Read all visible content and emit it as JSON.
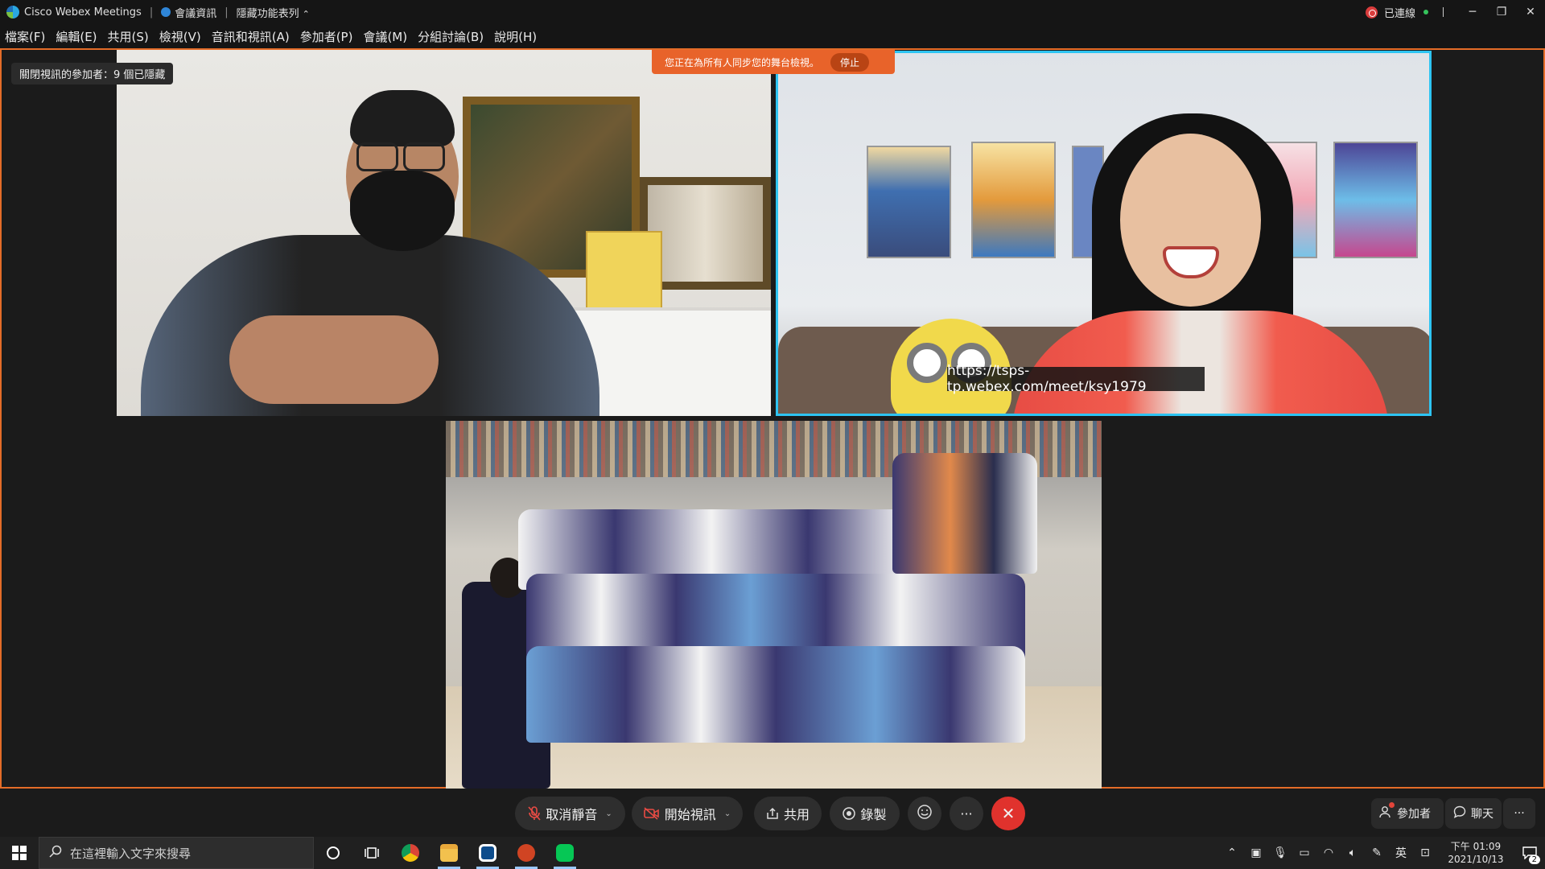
{
  "titlebar": {
    "app_name": "Cisco Webex Meetings",
    "meeting_info": "會議資訊",
    "hide_menu": "隱藏功能表列",
    "connection_status": "已連線"
  },
  "menubar": {
    "items": [
      "檔案(F)",
      "編輯(E)",
      "共用(S)",
      "檢視(V)",
      "音訊和視訊(A)",
      "參加者(P)",
      "會議(M)",
      "分組討論(B)",
      "說明(H)"
    ]
  },
  "stage": {
    "hidden_participants": "關閉視訊的參加者：9 個已隱藏",
    "sync_banner": "您正在為所有人同步您的舞台檢視。",
    "sync_stop": "停止",
    "video2_caption": "https://tsps-tp.webex.com/meet/ksy1979"
  },
  "controls": {
    "unmute": "取消靜音",
    "start_video": "開始視訊",
    "share": "共用",
    "record": "錄製",
    "more": "···",
    "participants": "參加者",
    "chat": "聊天",
    "panel_more": "···"
  },
  "taskbar": {
    "search_placeholder": "在這裡輸入文字來搜尋",
    "ime": "英",
    "time": "下午 01:09",
    "date": "2021/10/13",
    "notifications": "2"
  },
  "colors": {
    "accent_orange": "#e46c28",
    "active_speaker": "#2ec4f2",
    "end_call": "#e0322d"
  }
}
